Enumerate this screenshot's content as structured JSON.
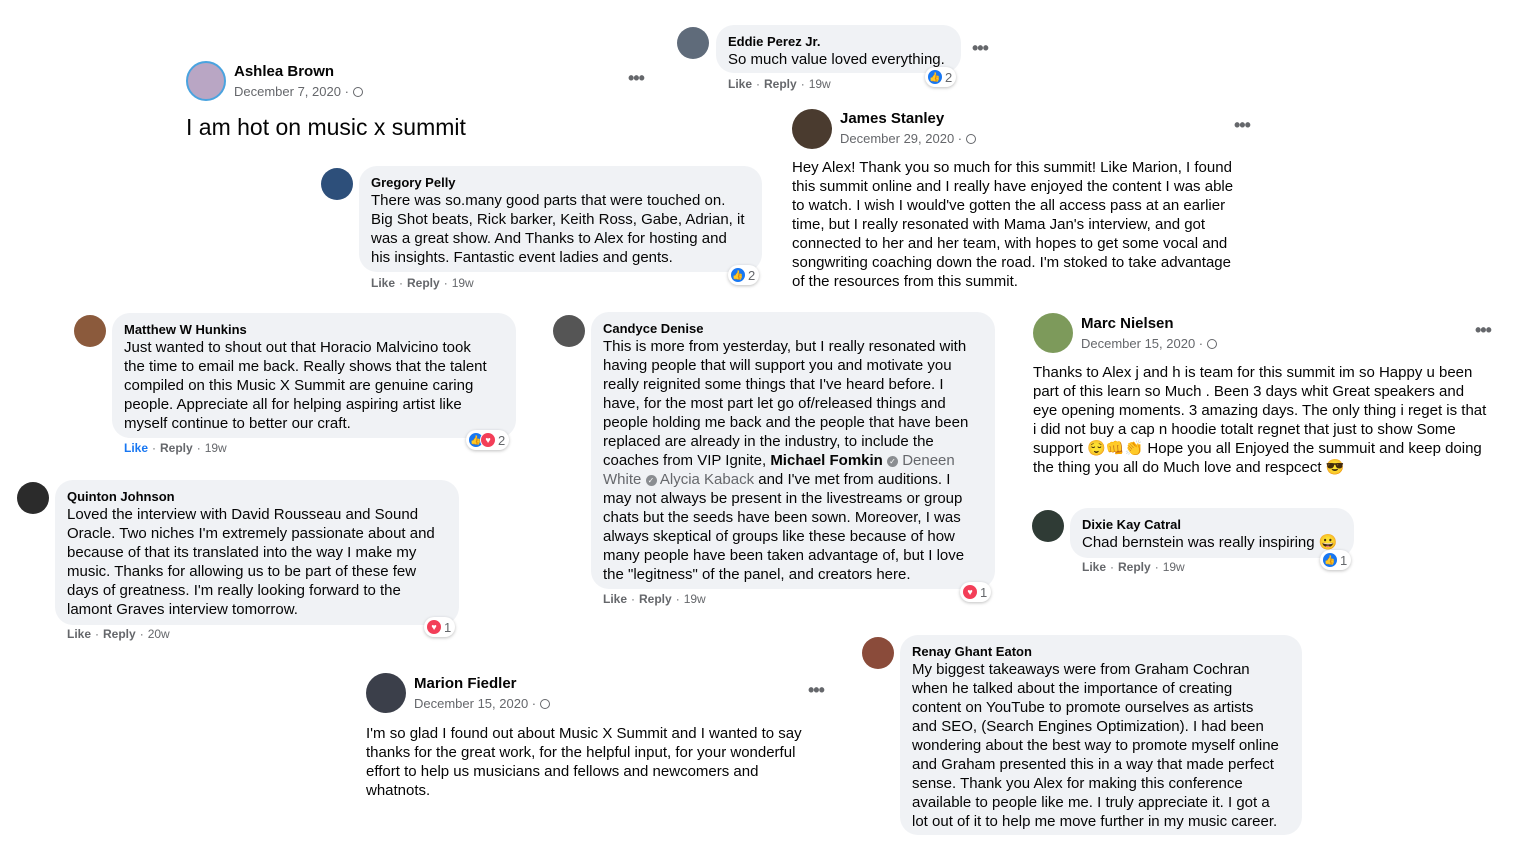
{
  "eddie": {
    "name": "Eddie Perez Jr.",
    "text": "So much value loved everything.",
    "like": "Like",
    "reply": "Reply",
    "age": "19w",
    "count": "2",
    "more": "•••",
    "avatar_color": "#5f6b7a"
  },
  "ashlea": {
    "name": "Ashlea Brown",
    "date": "December 7, 2020 ·",
    "text": "I am hot on music x summit",
    "more": "•••",
    "avatar_color": "#b9a6c4"
  },
  "james": {
    "name": "James Stanley",
    "date": "December 29, 2020 ·",
    "text": "Hey Alex! Thank you so much for this summit! Like Marion, I found\nthis summit  online and I really have enjoyed  the content I was able\nto watch. I wish I would've gotten the all access pass at an earlier\ntime, but I really resonated with Mama Jan's interview, and got\nconnected to her and her team, with hopes to get some vocal and\nsongwriting coaching down the road. I'm stoked to take advantage\nof the resources from this summit.",
    "more": "•••",
    "avatar_color": "#4a3b2f"
  },
  "gregory": {
    "name": "Gregory Pelly",
    "text": "There was so.many good parts that were touched on.\nBig Shot beats, Rick barker, Keith Ross, Gabe, Adrian, it\nwas a great show. And Thanks to Alex for hosting and\nhis insights. Fantastic event ladies and gents.",
    "like": "Like",
    "reply": "Reply",
    "age": "19w",
    "count": "2",
    "avatar_color": "#2d4f7a"
  },
  "matthew": {
    "name": "Matthew W Hunkins",
    "text": "Just wanted to shout out that Horacio Malvicino took\nthe time to email me back. Really shows that the talent\ncompiled on this Music X Summit are genuine caring\npeople. Appreciate all for helping aspiring artist like\nmyself continue to better our craft.",
    "like": "Like",
    "reply": "Reply",
    "age": "19w",
    "count": "2",
    "avatar_color": "#8b5a3c"
  },
  "candyce": {
    "name": "Candyce Denise",
    "text_a": "This is more from yesterday, but I really resonated with\nhaving people that will support you and motivate you\nreally reignited some things that I've heard before. I\nhave, for the most part let go of/released things and\npeople holding me back and the people that have been\nreplaced are already in the industry, to include the\ncoaches from VIP Ignite, ",
    "mention1": "Michael Fomkin",
    "mention2": "Deneen\nWhite",
    "mention3": "Alycia Kaback",
    "text_b": " and I've met from auditions. I\nmay not always be present in the livestreams or group\nchats but the seeds have been sown. Moreover, I was\nalways skeptical of groups like these because of how\nmany people have been taken advantage of, but I love\nthe \"legitness\" of the panel, and creators here.",
    "like": "Like",
    "reply": "Reply",
    "age": "19w",
    "count": "1",
    "avatar_color": "#555555"
  },
  "marc": {
    "name": "Marc Nielsen",
    "date": "December 15, 2020 ·",
    "text": "Thanks to Alex j and h is team for this summit im so Happy u been\npart of this learn so Much . Been 3 days whit Great speakers and\neye opening moments. 3 amazing days. The only thing i reget is that\ni did not  buy  a cap n hoodie  totalt regnet that just to show Some\nsupport 😌👊👏 Hope you all Enjoyed the summuit and keep doing\nthe thing you all do Much  love and respcect 😎",
    "more": "•••",
    "avatar_color": "#7d9a5b"
  },
  "quinton": {
    "name": "Quinton Johnson",
    "text": "Loved the interview with David Rousseau and Sound\nOracle. Two niches I'm extremely passionate about and\nbecause of that its translated into the way I make my\nmusic. Thanks for allowing us to be part of these few\ndays of greatness. I'm really looking forward to the\nlamont Graves interview tomorrow.",
    "like": "Like",
    "reply": "Reply",
    "age": "20w",
    "count": "1",
    "avatar_color": "#2b2b2b"
  },
  "dixie": {
    "name": "Dixie Kay Catral",
    "text": "Chad bernstein was really inspiring 😀",
    "like": "Like",
    "reply": "Reply",
    "age": "19w",
    "count": "1",
    "avatar_color": "#2f3b35"
  },
  "renay": {
    "name": "Renay Ghant Eaton",
    "text": "My biggest takeaways were from Graham Cochran\nwhen he talked about the importance of creating\ncontent on YouTube to promote ourselves as artists\nand SEO, (Search Engines Optimization). I had been\nwondering about the best way to promote myself online\nand Graham presented this in a way that made perfect\nsense. Thank you Alex for making this conference\navailable to people like me. I truly appreciate it. I got a\nlot out of it to help me move further in my music career.",
    "avatar_color": "#8a4b3a"
  },
  "marion": {
    "name": "Marion Fiedler",
    "date": "December 15, 2020 ·",
    "text": "I'm so glad I found out about Music X Summit and I wanted to say\nthanks for the great work, for the helpful input, for your wonderful\neffort to help us musicians and fellows and newcomers and\nwhatnots.",
    "more": "•••",
    "avatar_color": "#3b3f4a"
  },
  "icons": {
    "like": "👍",
    "love": "♥",
    "verified": "✓"
  }
}
